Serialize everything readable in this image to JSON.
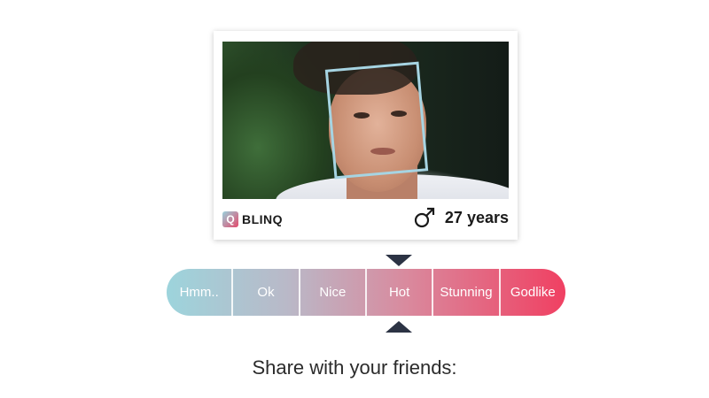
{
  "card": {
    "brand": {
      "logo_letter": "Q",
      "name": "BLINQ"
    },
    "gender_icon": "male-symbol-icon",
    "age_text": "27 years",
    "face_box_color": "#a6d4e2"
  },
  "rating": {
    "selected_index": 3,
    "options": [
      {
        "label": "Hmm.."
      },
      {
        "label": "Ok"
      },
      {
        "label": "Nice"
      },
      {
        "label": "Hot"
      },
      {
        "label": "Stunning"
      },
      {
        "label": "Godlike"
      }
    ],
    "gradient_colors": [
      "#9dd4dc",
      "#b9b9c8",
      "#d98a9e",
      "#f04062"
    ],
    "marker_color": "#2c3344"
  },
  "share": {
    "title": "Share with your friends:"
  }
}
